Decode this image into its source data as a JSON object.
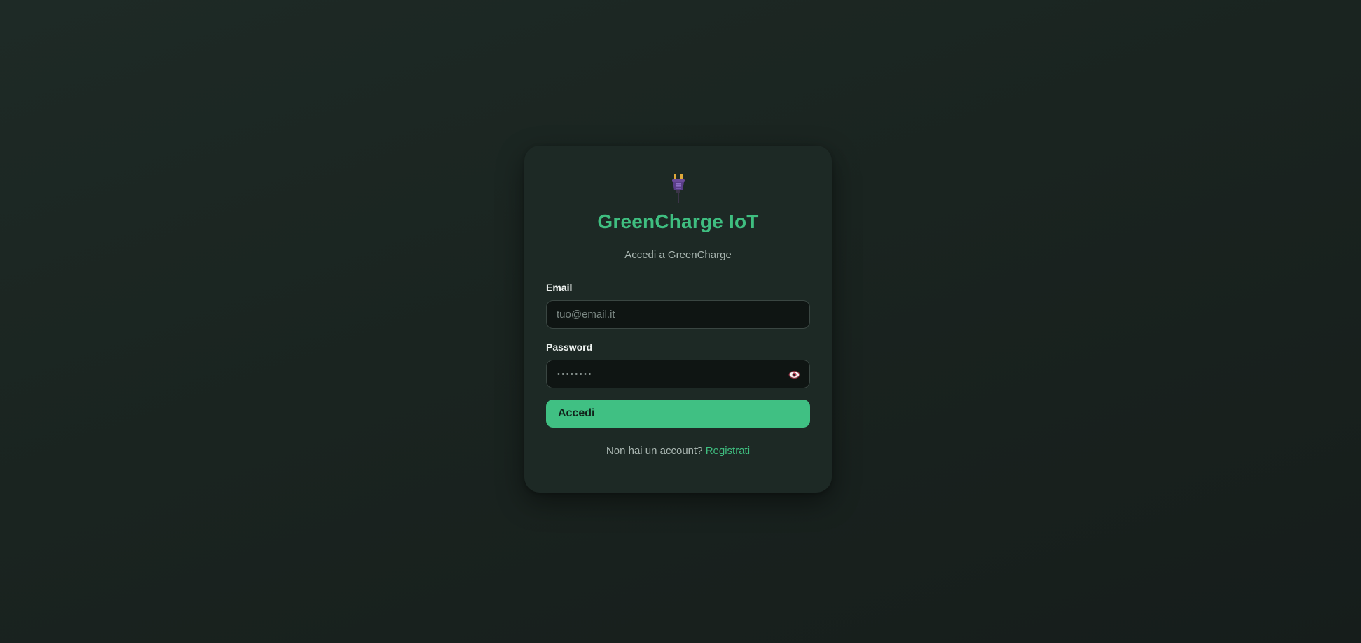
{
  "login": {
    "logo_icon": "electric-plug-icon",
    "title": "GreenCharge IoT",
    "subtitle": "Accedi a GreenCharge",
    "email_label": "Email",
    "email_placeholder": "tuo@email.it",
    "password_label": "Password",
    "password_mask": "••••••••",
    "show_password_icon": "eye-icon",
    "submit_label": "Accedi",
    "footer_text": "Non hai un account?",
    "register_link": "Registrati"
  },
  "colors": {
    "accent": "#40c083",
    "background": "#1a2420",
    "card": "#1d2925",
    "input_bg": "#0f1513"
  }
}
